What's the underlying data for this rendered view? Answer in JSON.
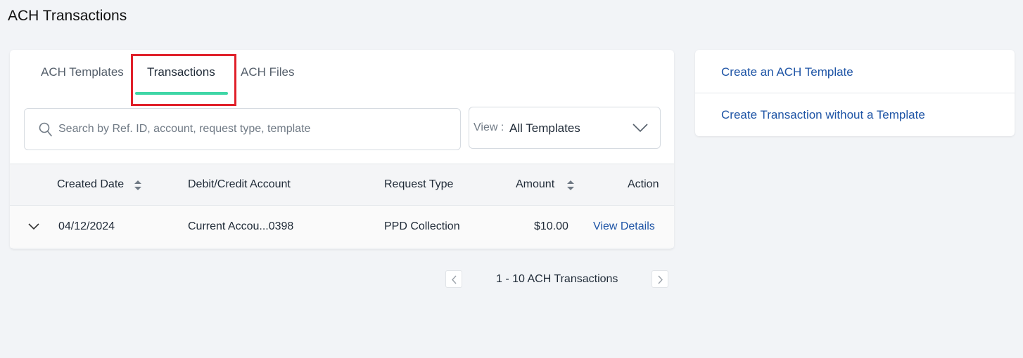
{
  "page": {
    "title": "ACH Transactions"
  },
  "tabs": [
    {
      "label": "ACH Templates",
      "active": false
    },
    {
      "label": "Transactions",
      "active": true
    },
    {
      "label": "ACH Files",
      "active": false
    }
  ],
  "search": {
    "placeholder": "Search by Ref. ID, account, request type, template",
    "value": ""
  },
  "view_filter": {
    "label": "View :",
    "value": "All Templates"
  },
  "table": {
    "headers": {
      "created_date": "Created Date",
      "account": "Debit/Credit Account",
      "request_type": "Request Type",
      "amount": "Amount",
      "action": "Action"
    },
    "rows": [
      {
        "created_date": "04/12/2024",
        "account": "Current Accou...0398",
        "request_type": "PPD Collection",
        "amount": "$10.00",
        "action": "View Details"
      }
    ]
  },
  "side_actions": [
    {
      "label": "Create an ACH Template"
    },
    {
      "label": "Create Transaction without a Template"
    }
  ],
  "pagination": {
    "text": "1 - 10 ACH Transactions"
  },
  "colors": {
    "accent": "#3fd6a6",
    "link": "#1f55a6",
    "highlight": "#e0202a",
    "background": "#f2f4f7"
  }
}
